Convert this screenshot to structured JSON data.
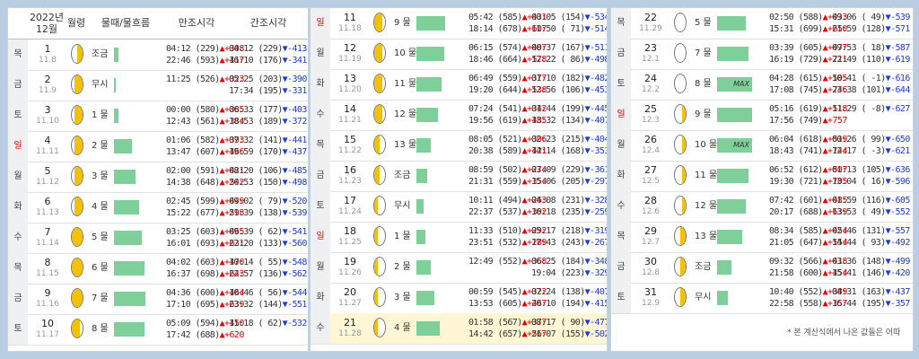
{
  "header": {
    "year": "2022년",
    "month": "12월",
    "age": "월령",
    "tide": "물때/물흐름",
    "high": "만조시각",
    "low": "간조시각"
  },
  "colors": {
    "bar": "#7fcf9a",
    "up": "#e00000",
    "down": "#1c3cd0",
    "sunday": "#e00000"
  },
  "note": "* 본 계산식에서 나온 값들은 어따",
  "columns": [
    {
      "rows": [
        {
          "wd": "목",
          "red": false,
          "day": "1",
          "lunar": "11.8",
          "moon": "first-quarter",
          "tide": "조금",
          "bar": 0.12,
          "max": false,
          "h1": "04:12 (229)",
          "h1d": "▲+308",
          "h2": "22:46 (593)",
          "h2d": "▲+417",
          "l1": "04:12 (229)",
          "l1d": "▼-413",
          "l2": "16:10 (176)",
          "l2d": "▼-341"
        },
        {
          "wd": "금",
          "red": false,
          "day": "2",
          "lunar": "11.9",
          "moon": "waxing-gibbous",
          "tide": "무시",
          "bar": 0.06,
          "max": false,
          "h1": "11:25 (526)",
          "h1d": "▲+323",
          "h2": "",
          "h2d": "",
          "l1": "05:25 (203)",
          "l1d": "▼-390",
          "l2": "17:34 (195)",
          "l2d": "▼-331"
        },
        {
          "wd": "토",
          "red": false,
          "day": "3",
          "lunar": "11.10",
          "moon": "waxing-gibbous",
          "tide": "1 물",
          "bar": 0.12,
          "max": false,
          "h1": "00:00 (580)",
          "h1d": "▲+385",
          "h2": "12:43 (561)",
          "h2d": "▲+384",
          "l1": "06:33 (177)",
          "l1d": "▼-403",
          "l2": "18:53 (189)",
          "l2d": "▼-372"
        },
        {
          "wd": "일",
          "red": true,
          "day": "4",
          "lunar": "11.11",
          "moon": "waxing-gibbous",
          "tide": "2 물",
          "bar": 0.5,
          "max": false,
          "h1": "01:06 (582)",
          "h1d": "▲+393",
          "h2": "13:47 (607)",
          "h2d": "▲+466",
          "l1": "07:32 (141)",
          "l1d": "▼-441",
          "l2": "19:59 (170)",
          "l2d": "▼-437"
        },
        {
          "wd": "월",
          "red": false,
          "day": "5",
          "lunar": "11.12",
          "moon": "waxing-gibbous",
          "tide": "3 물",
          "bar": 0.6,
          "max": false,
          "h1": "02:00 (591)",
          "h1d": "▲+421",
          "h2": "14:38 (648)",
          "h2d": "▲+542",
          "l1": "08:20 (106)",
          "l1d": "▼-485",
          "l2": "20:53 (150)",
          "l2d": "▼-498"
        },
        {
          "wd": "화",
          "red": false,
          "day": "6",
          "lunar": "11.13",
          "moon": "waxing-gibbous",
          "tide": "4 물",
          "bar": 0.7,
          "max": false,
          "h1": "02:45 (599)",
          "h1d": "▲+449",
          "h2": "15:22 (677)",
          "h2d": "▲+598",
          "l1": "09:02 ( 79)",
          "l1d": "▼-520",
          "l2": "21:39 (138)",
          "l2d": "▼-539"
        },
        {
          "wd": "수",
          "red": false,
          "day": "7",
          "lunar": "11.14",
          "moon": "full",
          "tide": "5 물",
          "bar": 0.78,
          "max": false,
          "h1": "03:25 (603)",
          "h1d": "▲+465",
          "h2": "16:01 (693)",
          "h2d": "▲+631",
          "l1": "09:39 ( 62)",
          "l1d": "▼-541",
          "l2": "22:20 (133)",
          "l2d": "▼-560"
        },
        {
          "wd": "목",
          "red": false,
          "day": "8",
          "lunar": "11.15",
          "moon": "full",
          "tide": "6 물",
          "bar": 0.85,
          "max": false,
          "h1": "04:02 (603)",
          "h1d": "▲+470",
          "h2": "16:37 (698)",
          "h2d": "▲+643",
          "l1": "10:14 ( 55)",
          "l1d": "▼-548",
          "l2": "22:57 (136)",
          "l2d": "▼-562"
        },
        {
          "wd": "금",
          "red": false,
          "day": "9",
          "lunar": "11.16",
          "moon": "full",
          "tide": "7 물",
          "bar": 0.88,
          "max": false,
          "h1": "04:36 (600)",
          "h1d": "▲+464",
          "h2": "17:10 (695)",
          "h2d": "▲+639",
          "l1": "10:46 ( 56)",
          "l1d": "▼-544",
          "l2": "23:32 (144)",
          "l2d": "▼-551"
        },
        {
          "wd": "토",
          "red": false,
          "day": "10",
          "lunar": "11.17",
          "moon": "waning-gibbous",
          "tide": "8 물",
          "bar": 0.85,
          "max": false,
          "h1": "05:09 (594)",
          "h1d": "▲+450",
          "h2": "17:42 (688)",
          "h2d": "▲+620",
          "l1": "11:18 ( 62)",
          "l1d": "▼-532",
          "l2": "",
          "l2d": ""
        }
      ]
    },
    {
      "rows": [
        {
          "wd": "일",
          "red": true,
          "day": "11",
          "lunar": "11.18",
          "moon": "waning-gibbous",
          "tide": "9 물",
          "bar": 0.8,
          "max": false,
          "h1": "05:42 (585)",
          "h1d": "▲+431",
          "h2": "18:14 (678)",
          "h2d": "▲+607",
          "l1": "00:05 (154)",
          "l1d": "▼-534",
          "l2": "11:50 ( 71)",
          "l2d": "▼-514"
        },
        {
          "wd": "월",
          "red": false,
          "day": "12",
          "lunar": "11.19",
          "moon": "waning-gibbous",
          "tide": "10 물",
          "bar": 0.78,
          "max": false,
          "h1": "06:15 (574)",
          "h1d": "▲+407",
          "h2": "18:46 (664)",
          "h2d": "▲+578",
          "l1": "00:37 (167)",
          "l1d": "▼-511",
          "l2": "12:22 ( 86)",
          "l2d": "▼-498"
        },
        {
          "wd": "화",
          "red": false,
          "day": "13",
          "lunar": "11.20",
          "moon": "waning-gibbous",
          "tide": "11 물",
          "bar": 0.7,
          "max": false,
          "h1": "06:49 (559)",
          "h1d": "▲+377",
          "h2": "19:20 (644)",
          "h2d": "▲+538",
          "l1": "01:10 (182)",
          "l1d": "▼-482",
          "l2": "12:56 (106)",
          "l2d": "▼-453"
        },
        {
          "wd": "수",
          "red": false,
          "day": "14",
          "lunar": "11.21",
          "moon": "waning-gibbous",
          "tide": "12 물",
          "bar": 0.6,
          "max": false,
          "h1": "07:24 (541)",
          "h1d": "▲+342",
          "h2": "19:56 (619)",
          "h2d": "▲+485",
          "l1": "01:44 (199)",
          "l1d": "▼-445",
          "l2": "13:32 (134)",
          "l2d": "▼-407"
        },
        {
          "wd": "목",
          "red": false,
          "day": "15",
          "lunar": "11.22",
          "moon": "last-quarter",
          "tide": "13 물",
          "bar": 0.4,
          "max": false,
          "h1": "08:05 (521)",
          "h1d": "▲+306",
          "h2": "20:38 (589)",
          "h2d": "▲+421",
          "l1": "02:23 (215)",
          "l1d": "▼-404",
          "l2": "14:14 (168)",
          "l2d": "▼-353"
        },
        {
          "wd": "금",
          "red": false,
          "day": "16",
          "lunar": "11.23",
          "moon": "last-quarter",
          "tide": "조금",
          "bar": 0.3,
          "max": false,
          "h1": "08:59 (502)",
          "h1d": "▲+274",
          "h2": "21:31 (559)",
          "h2d": "▲+354",
          "l1": "03:09 (229)",
          "l1d": "▼-361",
          "l2": "15:06 (205)",
          "l2d": "▼-297"
        },
        {
          "wd": "토",
          "red": false,
          "day": "17",
          "lunar": "11.24",
          "moon": "waning-crescent",
          "tide": "무시",
          "bar": 0.2,
          "max": false,
          "h1": "10:11 (494)",
          "h1d": "▲+263",
          "h2": "22:37 (537)",
          "h2d": "▲+302",
          "l1": "04:08 (231)",
          "l1d": "▼-328",
          "l2": "16:18 (235)",
          "l2d": "▼-259"
        },
        {
          "wd": "일",
          "red": true,
          "day": "18",
          "lunar": "11.25",
          "moon": "waning-crescent",
          "tide": "1 물",
          "bar": 0.25,
          "max": false,
          "h1": "11:33 (510)",
          "h1d": "▲+292",
          "h2": "23:51 (532)",
          "h2d": "▲+289",
          "l1": "05:17 (218)",
          "l1d": "▼-319",
          "l2": "17:43 (243)",
          "l2d": "▼-267"
        },
        {
          "wd": "월",
          "red": false,
          "day": "19",
          "lunar": "11.26",
          "moon": "waning-crescent",
          "tide": "2 물",
          "bar": 0.4,
          "max": false,
          "h1": "12:49 (552)",
          "h1d": "▲+368",
          "h2": "",
          "h2d": "",
          "l1": "06:25 (184)",
          "l1d": "▼-348",
          "l2": "19:04 (223)",
          "l2d": "▼-329"
        },
        {
          "wd": "화",
          "red": false,
          "day": "20",
          "lunar": "11.27",
          "moon": "waning-crescent",
          "tide": "3 물",
          "bar": 0.5,
          "max": false,
          "h1": "00:59 (545)",
          "h1d": "▲+322",
          "h2": "13:53 (605)",
          "h2d": "▲+467",
          "l1": "07:24 (138)",
          "l1d": "▼-407",
          "l2": "20:10 (194)",
          "l2d": "▼-415"
        },
        {
          "wd": "수",
          "red": false,
          "day": "21",
          "lunar": "11.28",
          "moon": "waning-crescent",
          "tide": "4 물",
          "bar": 0.65,
          "max": false,
          "hl": true,
          "h1": "01:58 (567)",
          "h1d": "▲+377",
          "h2": "14:42 (657)",
          "h2d": "▲+567",
          "l1": "08:17 ( 90)",
          "l1d": "▼-477",
          "l2": "21:07 (155)",
          "l2d": "▼-502"
        }
      ]
    },
    {
      "rows": [
        {
          "wd": "목",
          "red": false,
          "day": "22",
          "lunar": "11.29",
          "moon": "new",
          "tide": "5 물",
          "bar": 0.8,
          "max": false,
          "h1": "02:50 (588)",
          "h1d": "▲+433",
          "h2": "15:31 (699)",
          "h2d": "▲+650",
          "l1": "09:06 ( 49)",
          "l1d": "▼-539",
          "l2": "21:59 (128)",
          "l2d": "▼-571"
        },
        {
          "wd": "금",
          "red": false,
          "day": "23",
          "lunar": "12.1",
          "moon": "new",
          "tide": "7 물",
          "bar": 0.88,
          "max": false,
          "h1": "03:39 (605)",
          "h1d": "▲+477",
          "h2": "16:19 (729)",
          "h2d": "▲+711",
          "l1": "09:53 ( 18)",
          "l1d": "▼-587",
          "l2": "22:49 (110)",
          "l2d": "▼-619"
        },
        {
          "wd": "토",
          "red": false,
          "day": "24",
          "lunar": "12.2",
          "moon": "new",
          "tide": "8 물",
          "bar": 0.98,
          "max": true,
          "h1": "04:28 (615)",
          "h1d": "▲+505",
          "h2": "17:08 (745)",
          "h2d": "▲+746",
          "l1": "10:41 ( -1)",
          "l1d": "▼-616",
          "l2": "23:38 (101)",
          "l2d": "▼-644"
        },
        {
          "wd": "일",
          "red": true,
          "day": "25",
          "lunar": "12.3",
          "moon": "waxing-crescent",
          "tide": "9 물",
          "bar": 0.98,
          "max": false,
          "h1": "05:16 (619)",
          "h1d": "▲+518",
          "h2": "17:56 (749)",
          "h2d": "▲+757",
          "l1": "11:29 ( -8)",
          "l1d": "▼-627",
          "l2": "",
          "l2d": ""
        },
        {
          "wd": "월",
          "red": false,
          "day": "26",
          "lunar": "12.4",
          "moon": "waxing-crescent",
          "tide": "10 물",
          "bar": 0.98,
          "max": true,
          "h1": "06:04 (618)",
          "h1d": "▲+519",
          "h2": "18:43 (741)",
          "h2d": "▲+744",
          "l1": "00:26 ( 99)",
          "l1d": "▼-650",
          "l2": "12:17 ( -3)",
          "l2d": "▼-621"
        },
        {
          "wd": "화",
          "red": false,
          "day": "27",
          "lunar": "12.5",
          "moon": "waxing-crescent",
          "tide": "11 물",
          "bar": 0.88,
          "max": false,
          "h1": "06:52 (612)",
          "h1d": "▲+507",
          "h2": "19:30 (721)",
          "h2d": "▲+705",
          "l1": "01:13 (105)",
          "l1d": "▼-636",
          "l2": "13:04 ( 16)",
          "l2d": "▼-596"
        },
        {
          "wd": "수",
          "red": false,
          "day": "28",
          "lunar": "12.6",
          "moon": "waxing-crescent",
          "tide": "12 물",
          "bar": 0.8,
          "max": false,
          "h1": "07:42 (601)",
          "h1d": "▲+485",
          "h2": "20:17 (688)",
          "h2d": "▲+639",
          "l1": "01:59 (116)",
          "l1d": "▼-605",
          "l2": "13:53 ( 49)",
          "l2d": "▼-552"
        },
        {
          "wd": "목",
          "red": false,
          "day": "29",
          "lunar": "12.7",
          "moon": "first-quarter",
          "tide": "13 물",
          "bar": 0.7,
          "max": false,
          "h1": "08:34 (585)",
          "h1d": "▲+454",
          "h2": "21:05 (647)",
          "h2d": "▲+554",
          "l1": "02:46 (131)",
          "l1d": "▼-557",
          "l2": "14:44 ( 93)",
          "l2d": "▼-492"
        },
        {
          "wd": "금",
          "red": false,
          "day": "30",
          "lunar": "12.8",
          "moon": "first-quarter",
          "tide": "조금",
          "bar": 0.4,
          "max": false,
          "h1": "09:32 (566)",
          "h1d": "▲+418",
          "h2": "21:58 (600)",
          "h2d": "▲+454",
          "l1": "03:36 (148)",
          "l1d": "▼-499",
          "l2": "15:41 (146)",
          "l2d": "▼-420"
        },
        {
          "wd": "토",
          "red": false,
          "day": "31",
          "lunar": "12.9",
          "moon": "first-quarter",
          "tide": "무시",
          "bar": 0.3,
          "max": false,
          "h1": "10:40 (552)",
          "h1d": "▲+389",
          "h2": "22:58 (558)",
          "h2d": "▲+357",
          "l1": "04:31 (163)",
          "l1d": "▼-437",
          "l2": "16:44 (195)",
          "l2d": "▼-357"
        }
      ]
    }
  ]
}
